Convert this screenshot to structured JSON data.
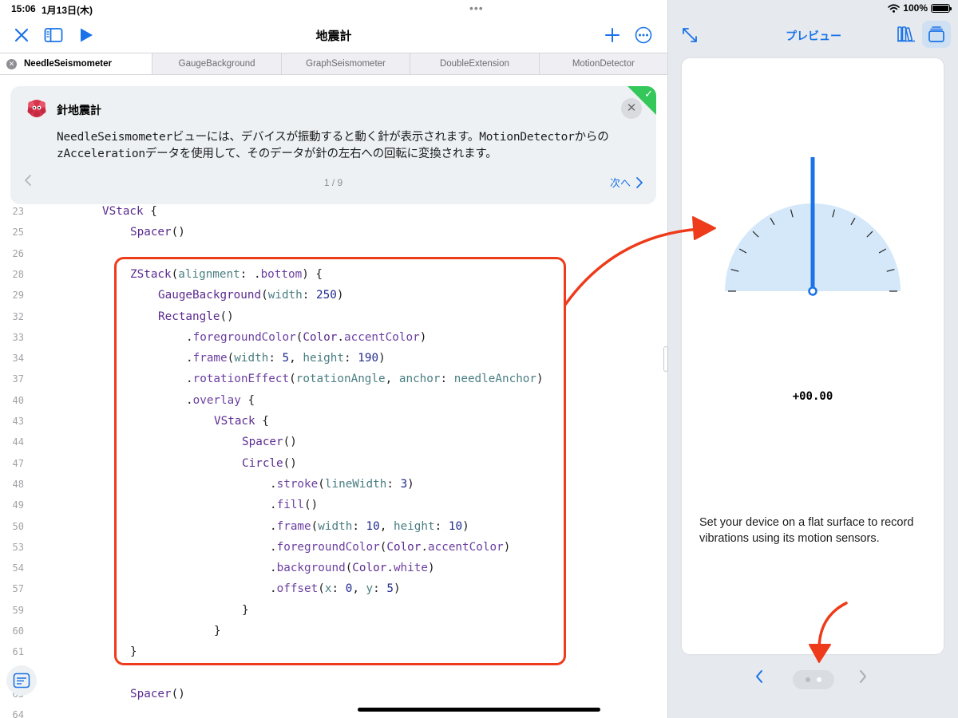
{
  "status": {
    "time": "15:06",
    "date": "1月13日(木)",
    "dots": "•••",
    "battery_level": "100%"
  },
  "editor": {
    "title": "地震計",
    "tabs": [
      {
        "label": "NeedleSeismometer",
        "active": true
      },
      {
        "label": "GaugeBackground",
        "active": false
      },
      {
        "label": "GraphSeismometer",
        "active": false
      },
      {
        "label": "DoubleExtension",
        "active": false
      },
      {
        "label": "MotionDetector",
        "active": false
      }
    ],
    "tip": {
      "title": "針地震計",
      "body": "NeedleSeismometerビューには、デバイスが振動すると動く針が表示されます。MotionDetectorからのzAccelerationデータを使用して、そのデータが針の左右への回転に変換されます。",
      "page": "1 / 9",
      "next_label": "次へ"
    },
    "code_lines": [
      {
        "n": "23",
        "indent": 2,
        "parts": [
          [
            "kw",
            "VStack"
          ],
          [
            "txt",
            " {"
          ]
        ]
      },
      {
        "n": "25",
        "indent": 3,
        "parts": [
          [
            "kw",
            "Spacer"
          ],
          [
            "txt",
            "()"
          ]
        ]
      },
      {
        "n": "26",
        "indent": 0,
        "parts": []
      },
      {
        "n": "28",
        "indent": 3,
        "parts": [
          [
            "kw",
            "ZStack"
          ],
          [
            "txt",
            "("
          ],
          [
            "param",
            "alignment"
          ],
          [
            "txt",
            ": ."
          ],
          [
            "mod",
            "bottom"
          ],
          [
            "txt",
            ") {"
          ]
        ]
      },
      {
        "n": "29",
        "indent": 4,
        "parts": [
          [
            "kw",
            "GaugeBackground"
          ],
          [
            "txt",
            "("
          ],
          [
            "param",
            "width"
          ],
          [
            "txt",
            ": "
          ],
          [
            "num",
            "250"
          ],
          [
            "txt",
            ")"
          ]
        ]
      },
      {
        "n": "32",
        "indent": 4,
        "parts": [
          [
            "kw",
            "Rectangle"
          ],
          [
            "txt",
            "()"
          ]
        ]
      },
      {
        "n": "33",
        "indent": 5,
        "parts": [
          [
            "txt",
            "."
          ],
          [
            "mod",
            "foregroundColor"
          ],
          [
            "txt",
            "("
          ],
          [
            "kw",
            "Color"
          ],
          [
            "txt",
            "."
          ],
          [
            "mod",
            "accentColor"
          ],
          [
            "txt",
            ")"
          ]
        ]
      },
      {
        "n": "34",
        "indent": 5,
        "parts": [
          [
            "txt",
            "."
          ],
          [
            "mod",
            "frame"
          ],
          [
            "txt",
            "("
          ],
          [
            "param",
            "width"
          ],
          [
            "txt",
            ": "
          ],
          [
            "num",
            "5"
          ],
          [
            "txt",
            ", "
          ],
          [
            "param",
            "height"
          ],
          [
            "txt",
            ": "
          ],
          [
            "num",
            "190"
          ],
          [
            "txt",
            ")"
          ]
        ]
      },
      {
        "n": "37",
        "indent": 5,
        "parts": [
          [
            "txt",
            "."
          ],
          [
            "mod",
            "rotationEffect"
          ],
          [
            "txt",
            "("
          ],
          [
            "param",
            "rotationAngle"
          ],
          [
            "txt",
            ", "
          ],
          [
            "param",
            "anchor"
          ],
          [
            "txt",
            ": "
          ],
          [
            "param",
            "needleAnchor"
          ],
          [
            "txt",
            ")"
          ]
        ]
      },
      {
        "n": "40",
        "indent": 5,
        "parts": [
          [
            "txt",
            "."
          ],
          [
            "mod",
            "overlay"
          ],
          [
            "txt",
            " {"
          ]
        ]
      },
      {
        "n": "43",
        "indent": 6,
        "parts": [
          [
            "kw",
            "VStack"
          ],
          [
            "txt",
            " {"
          ]
        ]
      },
      {
        "n": "44",
        "indent": 7,
        "parts": [
          [
            "kw",
            "Spacer"
          ],
          [
            "txt",
            "()"
          ]
        ]
      },
      {
        "n": "47",
        "indent": 7,
        "parts": [
          [
            "kw",
            "Circle"
          ],
          [
            "txt",
            "()"
          ]
        ]
      },
      {
        "n": "48",
        "indent": 8,
        "parts": [
          [
            "txt",
            "."
          ],
          [
            "mod",
            "stroke"
          ],
          [
            "txt",
            "("
          ],
          [
            "param",
            "lineWidth"
          ],
          [
            "txt",
            ": "
          ],
          [
            "num",
            "3"
          ],
          [
            "txt",
            ")"
          ]
        ]
      },
      {
        "n": "49",
        "indent": 8,
        "parts": [
          [
            "txt",
            "."
          ],
          [
            "mod",
            "fill"
          ],
          [
            "txt",
            "()"
          ]
        ]
      },
      {
        "n": "50",
        "indent": 8,
        "parts": [
          [
            "txt",
            "."
          ],
          [
            "mod",
            "frame"
          ],
          [
            "txt",
            "("
          ],
          [
            "param",
            "width"
          ],
          [
            "txt",
            ": "
          ],
          [
            "num",
            "10"
          ],
          [
            "txt",
            ", "
          ],
          [
            "param",
            "height"
          ],
          [
            "txt",
            ": "
          ],
          [
            "num",
            "10"
          ],
          [
            "txt",
            ")"
          ]
        ]
      },
      {
        "n": "53",
        "indent": 8,
        "parts": [
          [
            "txt",
            "."
          ],
          [
            "mod",
            "foregroundColor"
          ],
          [
            "txt",
            "("
          ],
          [
            "kw",
            "Color"
          ],
          [
            "txt",
            "."
          ],
          [
            "mod",
            "accentColor"
          ],
          [
            "txt",
            ")"
          ]
        ]
      },
      {
        "n": "54",
        "indent": 8,
        "parts": [
          [
            "txt",
            "."
          ],
          [
            "mod",
            "background"
          ],
          [
            "txt",
            "("
          ],
          [
            "kw",
            "Color"
          ],
          [
            "txt",
            "."
          ],
          [
            "mod",
            "white"
          ],
          [
            "txt",
            ")"
          ]
        ]
      },
      {
        "n": "57",
        "indent": 8,
        "parts": [
          [
            "txt",
            "."
          ],
          [
            "mod",
            "offset"
          ],
          [
            "txt",
            "("
          ],
          [
            "param",
            "x"
          ],
          [
            "txt",
            ": "
          ],
          [
            "num",
            "0"
          ],
          [
            "txt",
            ", "
          ],
          [
            "param",
            "y"
          ],
          [
            "txt",
            ": "
          ],
          [
            "num",
            "5"
          ],
          [
            "txt",
            ")"
          ]
        ]
      },
      {
        "n": "59",
        "indent": 7,
        "parts": [
          [
            "txt",
            "}"
          ]
        ]
      },
      {
        "n": "60",
        "indent": 6,
        "parts": [
          [
            "txt",
            "}"
          ]
        ]
      },
      {
        "n": "61",
        "indent": 3,
        "parts": [
          [
            "txt",
            "}"
          ]
        ]
      },
      {
        "n": "",
        "indent": 0,
        "parts": []
      },
      {
        "n": "63",
        "indent": 3,
        "parts": [
          [
            "kw",
            "Spacer"
          ],
          [
            "txt",
            "()"
          ]
        ]
      },
      {
        "n": "64",
        "indent": 0,
        "parts": []
      }
    ]
  },
  "preview": {
    "title": "プレビュー",
    "readout": "+00.00",
    "instruction": "Set your device on a flat surface to record vibrations using its motion sensors.",
    "page_count": 2,
    "active_page": 2
  },
  "colors": {
    "accent": "#1a73e8",
    "annotation": "#ee3b1b",
    "gauge_fill": "#d4e8fa",
    "check": "#34c759"
  }
}
